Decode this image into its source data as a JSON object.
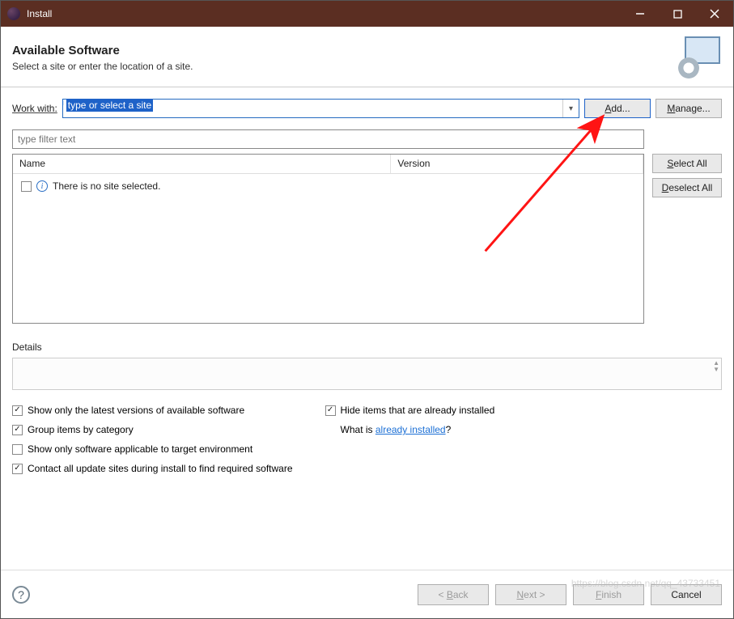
{
  "titlebar": {
    "title": "Install"
  },
  "header": {
    "title": "Available Software",
    "subtitle": "Select a site or enter the location of a site."
  },
  "workwith": {
    "label": "Work with:",
    "placeholder": "type or select a site",
    "add_btn": "Add...",
    "manage_btn": "Manage..."
  },
  "filter": {
    "placeholder": "type filter text"
  },
  "list": {
    "col_name": "Name",
    "col_version": "Version",
    "empty_msg": "There is no site selected."
  },
  "sidebuttons": {
    "select_all": "Select All",
    "deselect_all": "Deselect All"
  },
  "details": {
    "label": "Details"
  },
  "options": {
    "left": [
      "Show only the latest versions of available software",
      "Group items by category",
      "Show only software applicable to target environment",
      "Contact all update sites during install to find required software"
    ],
    "left_checked": [
      true,
      true,
      false,
      true
    ],
    "right_hide": "Hide items that are already installed",
    "right_hide_checked": true,
    "right_whatis_prefix": "What is ",
    "right_whatis_link": "already installed",
    "right_whatis_suffix": "?"
  },
  "footer": {
    "back": "< Back",
    "next": "Next >",
    "finish": "Finish",
    "cancel": "Cancel"
  },
  "watermark": "https://blog.csdn.net/qq_43733451"
}
